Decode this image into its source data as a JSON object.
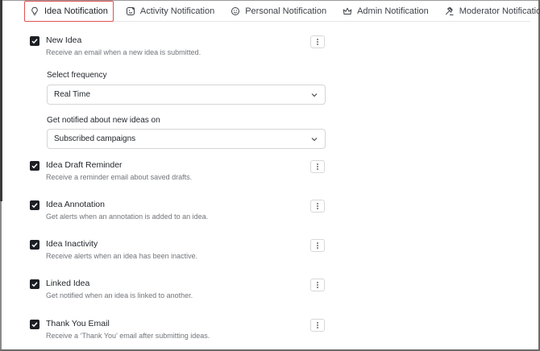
{
  "tabs": [
    {
      "label": "Idea Notification",
      "icon": "lightbulb-icon",
      "active": true
    },
    {
      "label": "Activity Notification",
      "icon": "activity-icon",
      "active": false
    },
    {
      "label": "Personal Notification",
      "icon": "face-icon",
      "active": false
    },
    {
      "label": "Admin Notification",
      "icon": "crown-icon",
      "active": false
    },
    {
      "label": "Moderator Notification",
      "icon": "gavel-icon",
      "active": false
    }
  ],
  "notifications": [
    {
      "title": "New Idea",
      "description": "Receive an email when a new idea is submitted.",
      "checked": true
    },
    {
      "title": "Idea Draft Reminder",
      "description": "Receive a reminder email about saved drafts.",
      "checked": true
    },
    {
      "title": "Idea Annotation",
      "description": "Get alerts when an annotation is added to an idea.",
      "checked": true
    },
    {
      "title": "Idea Inactivity",
      "description": "Receive alerts when an idea has been inactive.",
      "checked": true
    },
    {
      "title": "Linked Idea",
      "description": "Get notified when an idea is linked to another.",
      "checked": true
    },
    {
      "title": "Thank You Email",
      "description": "Receive a ‘Thank You’ email after submitting ideas.",
      "checked": true
    }
  ],
  "new_idea_settings": {
    "frequency_label": "Select frequency",
    "frequency_value": "Real Time",
    "scope_label": "Get notified about new ideas on",
    "scope_value": "Subscribed campaigns"
  },
  "colors": {
    "active_tab_border": "#e05252",
    "checkbox": "#1c1f24"
  }
}
